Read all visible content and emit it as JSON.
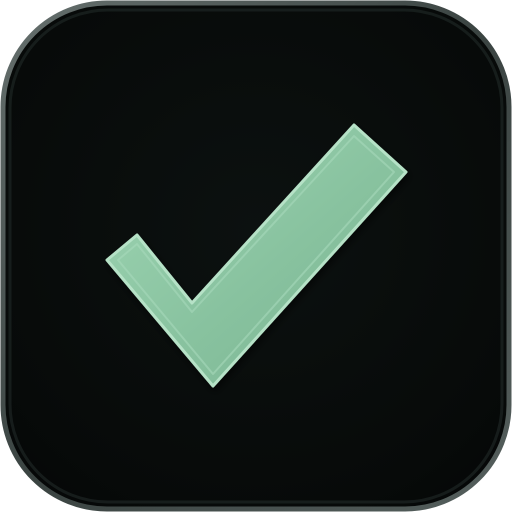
{
  "app_icon": {
    "icon": "checkmark-icon",
    "colors": {
      "tile_background": "#0a0d0c",
      "tile_edge": "#4a5452",
      "check_fill": "#8fc7a6",
      "check_edge": "#b6e2c7",
      "check_shadow": "#5d8f73"
    }
  }
}
